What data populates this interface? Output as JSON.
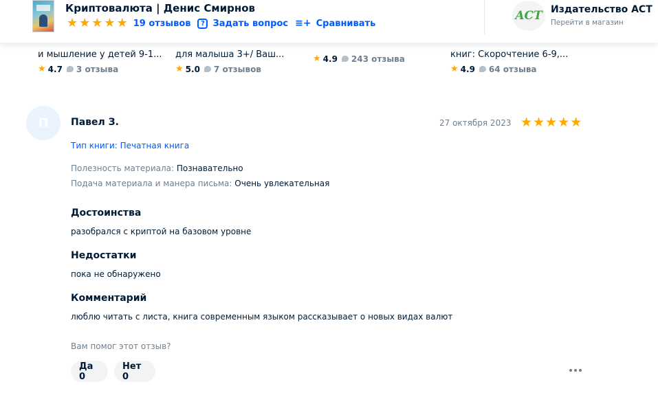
{
  "header": {
    "product_title": "Криптовалюта | Денис Смирнов",
    "reviews_link": "19 отзывов",
    "ask_link": "Задать вопрос",
    "compare_link": "Сравнивать",
    "publisher_name": "Издательство АСТ",
    "publisher_logo_text": "ACT",
    "publisher_link": "Перейти в магазин"
  },
  "related": [
    {
      "title": "и мышление у детей 9-1...",
      "rating": "4.7",
      "count": "3 отзыва"
    },
    {
      "title": "для малыша 3+/ Ваш...",
      "rating": "5.0",
      "count": "7 отзывов"
    },
    {
      "title": "",
      "rating": "4.9",
      "count": "243 отзыва"
    },
    {
      "title": "книг: Скорочтение 6-9,...",
      "rating": "4.9",
      "count": "64 отзыва"
    }
  ],
  "review": {
    "avatar_letter": "П",
    "author": "Павел З.",
    "date": "27 октября 2023",
    "rating": 5,
    "book_type": "Тип книги: Печатная книга",
    "params": [
      {
        "key": "Полезность материала:",
        "value": "Познавательно"
      },
      {
        "key": "Подача материала и манера письма:",
        "value": "Очень увлекательная"
      }
    ],
    "sections": [
      {
        "heading": "Достоинства",
        "text": "разобрался с криптой на базовом уровне"
      },
      {
        "heading": "Недостатки",
        "text": "пока не обнаружено"
      },
      {
        "heading": "Комментарий",
        "text": "люблю читать с листа, книга современным языком рассказывает о новых видах валют"
      }
    ],
    "helpful_question": "Вам помог этот отзыв?",
    "yes_label": "Да 0",
    "no_label": "Нет 0"
  },
  "colors": {
    "accent": "#005bff",
    "star": "#ffa800",
    "text": "#001a34",
    "muted": "#707f8d"
  }
}
